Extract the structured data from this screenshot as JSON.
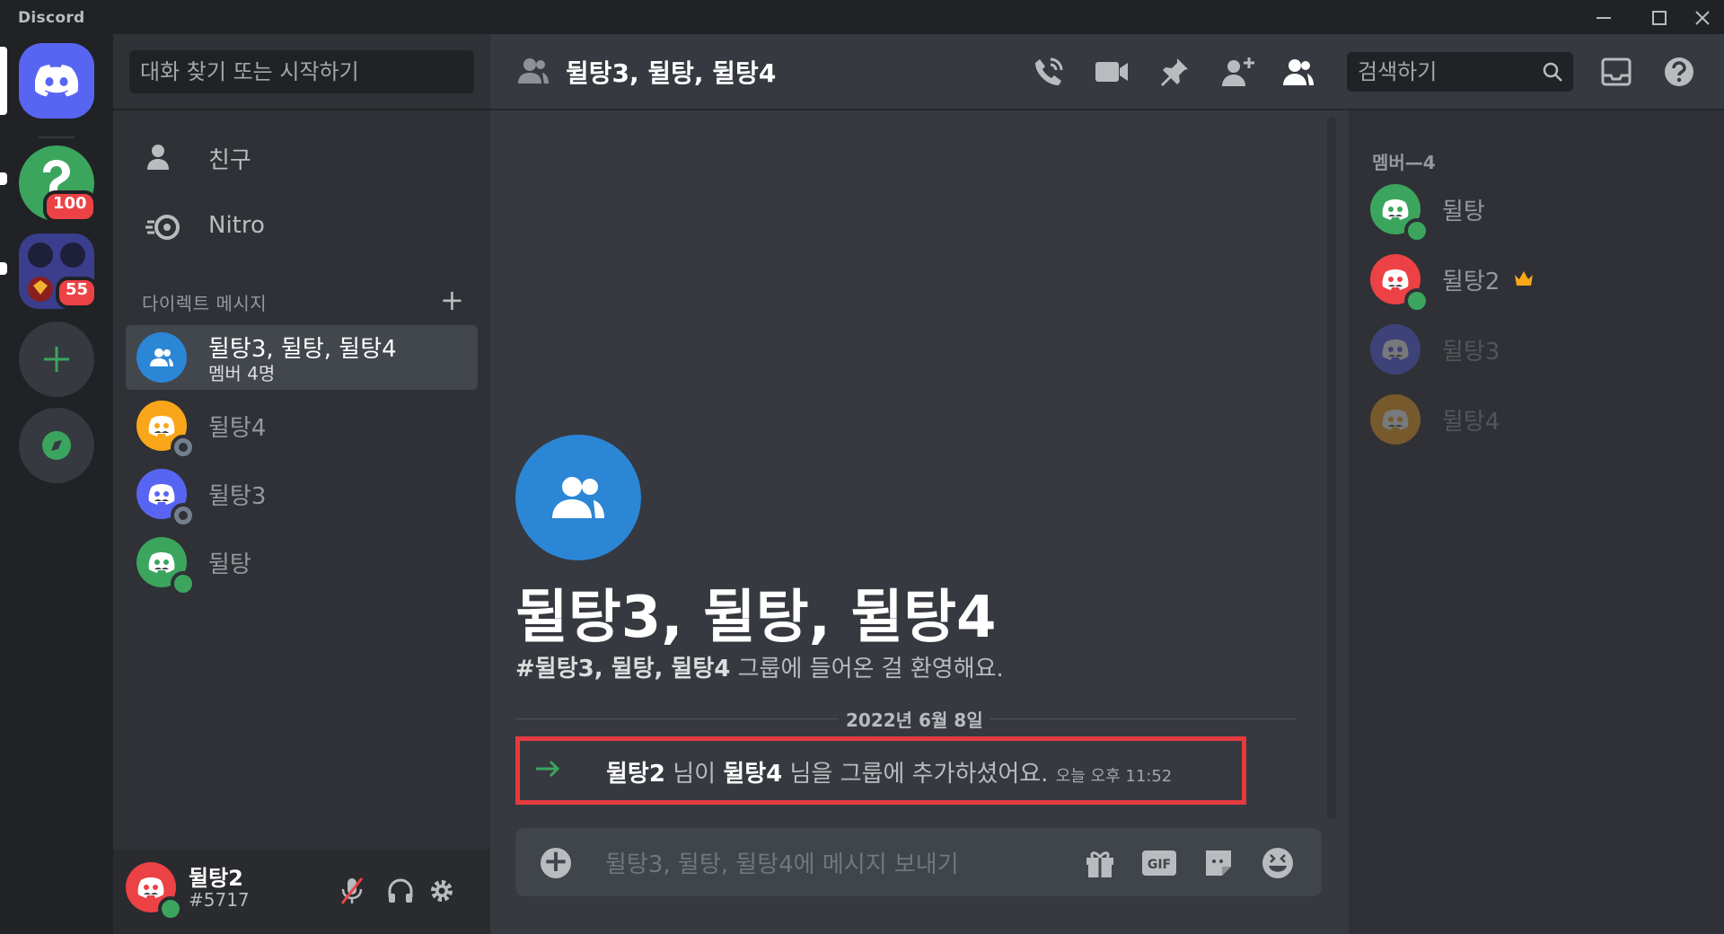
{
  "app": {
    "brand": "Discord"
  },
  "servers": [
    {
      "name": "home",
      "badge": ""
    },
    {
      "name": "help-server",
      "badge": "100"
    },
    {
      "name": "group-server",
      "badge": "55"
    }
  ],
  "dm_sidebar": {
    "search_placeholder": "대화 찾기 또는 시작하기",
    "nav": [
      {
        "label": "친구",
        "icon": "friends-icon"
      },
      {
        "label": "Nitro",
        "icon": "nitro-icon"
      }
    ],
    "section_title": "다이렉트 메시지",
    "dms": [
      {
        "name": "뒬탕3, 뒬탕, 뒬탕4",
        "sub": "멤버 4명",
        "active": true,
        "color": "#2c86d6"
      },
      {
        "name": "뒬탕4",
        "status": "offline",
        "color": "#faa61a"
      },
      {
        "name": "뒬탕3",
        "status": "offline",
        "color": "#5865f2"
      },
      {
        "name": "뒬탕",
        "status": "online",
        "color": "#3ba55d"
      }
    ]
  },
  "user": {
    "name": "뒬탕2",
    "tag": "#5717",
    "color": "#ed4245"
  },
  "header": {
    "title": "뒬탕3, 뒬탕, 뒬탕4",
    "search_placeholder": "검색하기"
  },
  "main": {
    "welcome_title": "뒬탕3, 뒬탕, 뒬탕4",
    "welcome_desc_prefix": "#",
    "welcome_desc_group": "뒬탕3, 뒬탕, 뒬탕4",
    "welcome_desc_suffix": " 그룹에 들어온 걸 환영해요.",
    "date_divider": "2022년 6월 8일",
    "system_message": {
      "actor": "뒬탕2",
      "mid1": " 님이 ",
      "target": "뒬탕4",
      "mid2": " 님을 그룹에 추가하셨어요.",
      "time": "오늘 오후 11:52"
    },
    "composer_placeholder": "뒬탕3, 뒬탕, 뒬탕4에 메시지 보내기"
  },
  "members": {
    "header": "멤버—4",
    "list": [
      {
        "name": "뒬탕",
        "status": "online",
        "color": "#3ba55d",
        "owner": false
      },
      {
        "name": "뒬탕2",
        "status": "online",
        "color": "#ed4245",
        "owner": true
      },
      {
        "name": "뒬탕3",
        "status": "offline",
        "color": "#5865f2",
        "owner": false
      },
      {
        "name": "뒬탕4",
        "status": "offline",
        "color": "#faa61a",
        "owner": false
      }
    ]
  },
  "colors": {
    "blurple": "#5865f2",
    "online": "#3ba55d",
    "highlight_border": "#e53a3f"
  }
}
